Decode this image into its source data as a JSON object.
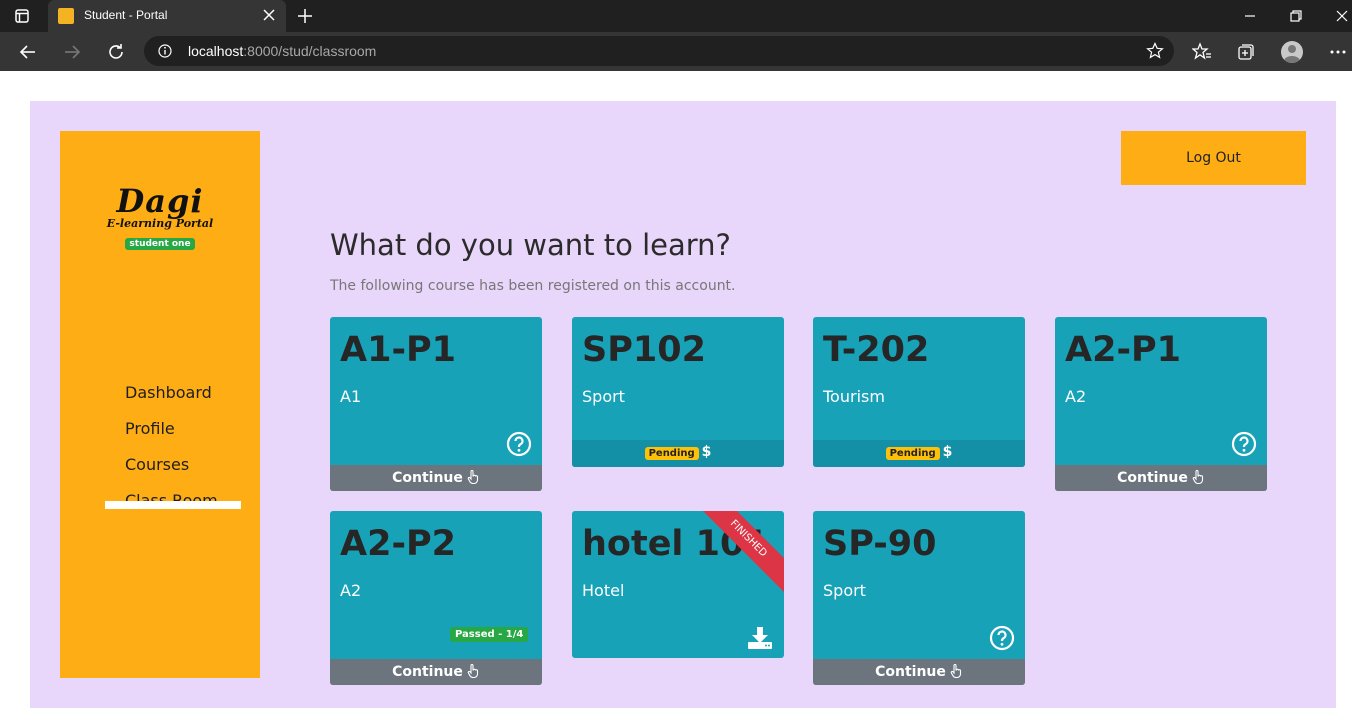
{
  "browser": {
    "tab_title": "Student - Portal",
    "url_host": "localhost",
    "url_path": ":8000/stud/classroom"
  },
  "sidebar": {
    "logo_text": "Dagi",
    "logo_subtitle": "E-learning Portal",
    "user_badge": "student one",
    "items": [
      {
        "label": "Dashboard"
      },
      {
        "label": "Profile"
      },
      {
        "label": "Courses"
      },
      {
        "label": "Class Room",
        "active": true
      }
    ]
  },
  "header": {
    "logout_label": "Log Out"
  },
  "main": {
    "title": "What do you want to learn?",
    "subtitle": "The following course has been registered on this account."
  },
  "courses": [
    {
      "code": "A1-P1",
      "name": "A1",
      "action": "Continue"
    },
    {
      "code": "SP102",
      "name": "Sport",
      "status": "Pending",
      "currency": "$"
    },
    {
      "code": "T-202",
      "name": "Tourism",
      "status": "Pending",
      "currency": "$"
    },
    {
      "code": "A2-P1",
      "name": "A2",
      "action": "Continue"
    },
    {
      "code": "A2-P2",
      "name": "A2",
      "badge": "Passed - 1/4",
      "action": "Continue"
    },
    {
      "code": "hotel 101",
      "name": "Hotel",
      "ribbon": "FINISHED"
    },
    {
      "code": "SP-90",
      "name": "Sport",
      "action": "Continue"
    }
  ],
  "colors": {
    "page_bg": "#e9d6fb",
    "sidebar_bg": "#ffad14",
    "card_bg": "#17a2b8",
    "continue_bg": "#6c757d",
    "pending_badge": "#ffc107",
    "passed_badge": "#28a745",
    "ribbon": "#dc3545"
  }
}
